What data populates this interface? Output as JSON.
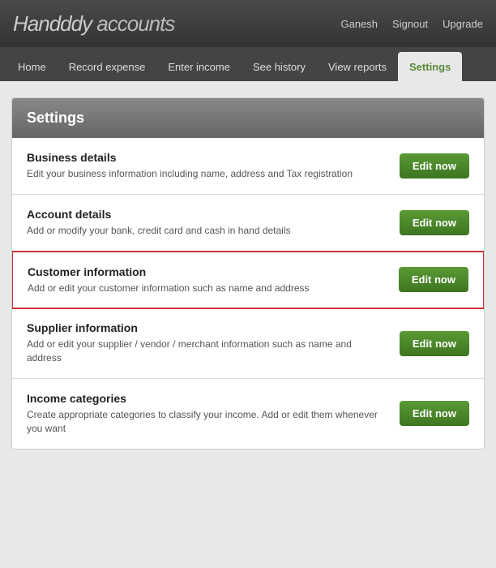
{
  "app": {
    "logo_brand": "Handddy",
    "logo_suffix": " accounts"
  },
  "header_nav": {
    "user": "Ganesh",
    "signout": "Signout",
    "upgrade": "Upgrade"
  },
  "tabs": [
    {
      "id": "home",
      "label": "Home",
      "active": false
    },
    {
      "id": "record-expense",
      "label": "Record expense",
      "active": false
    },
    {
      "id": "enter-income",
      "label": "Enter income",
      "active": false
    },
    {
      "id": "see-history",
      "label": "See history",
      "active": false
    },
    {
      "id": "view-reports",
      "label": "View reports",
      "active": false
    },
    {
      "id": "settings",
      "label": "Settings",
      "active": true
    }
  ],
  "settings": {
    "title": "Settings",
    "rows": [
      {
        "id": "business-details",
        "title": "Business details",
        "description": "Edit your business information including name, address and Tax registration",
        "button_label": "Edit now",
        "highlighted": false
      },
      {
        "id": "account-details",
        "title": "Account details",
        "description": "Add or modify your bank, credit card and cash in hand details",
        "button_label": "Edit now",
        "highlighted": false
      },
      {
        "id": "customer-information",
        "title": "Customer information",
        "description": "Add or edit your customer information such as name and address",
        "button_label": "Edit now",
        "highlighted": true
      },
      {
        "id": "supplier-information",
        "title": "Supplier information",
        "description": "Add or edit your supplier / vendor / merchant information such as name and address",
        "button_label": "Edit now",
        "highlighted": false
      },
      {
        "id": "income-categories",
        "title": "Income categories",
        "description": "Create appropriate categories to classify your income. Add or edit them whenever you want",
        "button_label": "Edit now",
        "highlighted": false
      }
    ]
  }
}
